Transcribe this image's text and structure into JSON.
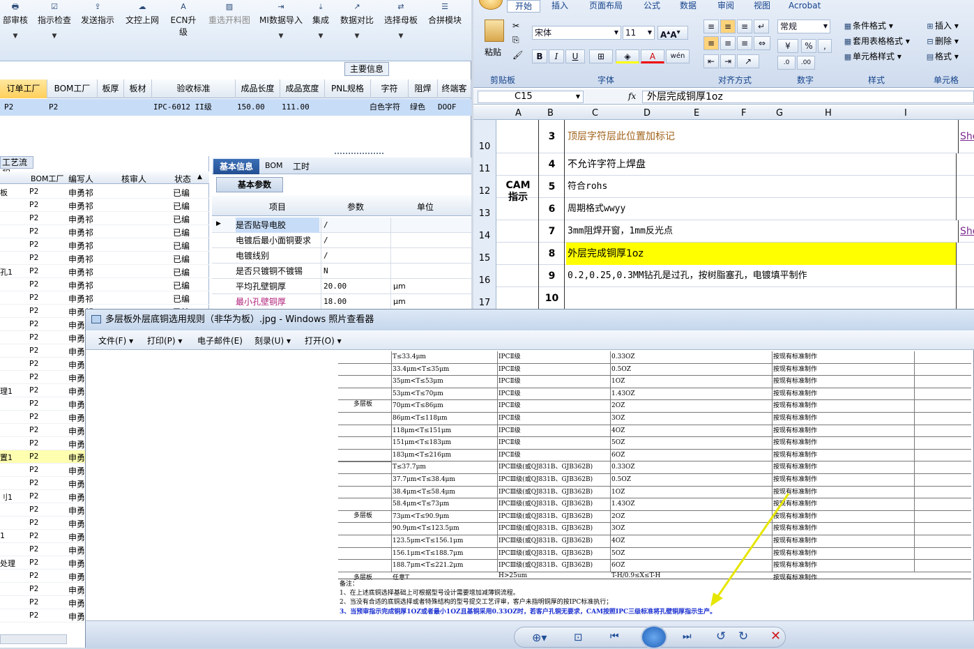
{
  "left_toolbar": [
    "部审核",
    "指示检查",
    "发送指示",
    "文控上网",
    "ECN升级",
    "重选开料图",
    "MI数据导入",
    "集成",
    "数据对比",
    "选择母板",
    "合拼模块"
  ],
  "main_info_label": "主要信息",
  "grid_headers": [
    "订单工厂",
    "BOM工厂",
    "板厚",
    "板材",
    "验收标准",
    "成品长度",
    "成品宽度",
    "PNL规格",
    "字符",
    "阻焊",
    "终端客"
  ],
  "grid_row": [
    "P2",
    "P2",
    "",
    "",
    "IPC-6012 II级",
    "150.00",
    "111.00",
    "",
    "白色字符",
    "绿色",
    "DOOF"
  ],
  "flow_title": "工艺流程",
  "flow_headers": [
    "BOM工厂",
    "编写人",
    "核审人",
    "状态"
  ],
  "flow_left_labels": [
    "板",
    "",
    "",
    "",
    "",
    "",
    "孔1",
    "",
    "",
    "",
    "",
    "",
    "",
    "",
    "",
    "",
    "理1",
    "",
    "",
    "",
    "",
    "",
    "",
    "",
    "",
    "",
    "",
    "",
    ""
  ],
  "flow_left_labels_b": {
    "6": "孔1",
    "15": "理1",
    "20": "置1",
    "23": "刂1",
    "26": "1",
    "28": "处理"
  },
  "flow_factory": "P2",
  "flow_writer": "申勇祁",
  "flow_writer_short": "申勇",
  "flow_status": "已编",
  "basic_tabs": [
    "基本信息",
    "BOM",
    "工时"
  ],
  "basic_subtab": "基本参数",
  "basic_headers": [
    "项目",
    "参数",
    "单位"
  ],
  "basic_rows": [
    [
      "是否贴导电胶",
      "/",
      ""
    ],
    [
      "电镀后最小面铜要求",
      "/",
      ""
    ],
    [
      "电镀线别",
      "/",
      ""
    ],
    [
      "是否只镀铜不镀锡",
      "N",
      ""
    ],
    [
      "平均孔壁铜厚",
      "20.00",
      "μm"
    ],
    [
      "最小孔壁铜厚",
      "18.00",
      "μm"
    ]
  ],
  "excel_tabs": [
    "开始",
    "插入",
    "页面布局",
    "公式",
    "数据",
    "审阅",
    "视图",
    "Acrobat"
  ],
  "excel_font": "宋体",
  "excel_size": "11",
  "excel_format": "常规",
  "excel_groups": [
    "剪贴板",
    "字体",
    "对齐方式",
    "数字",
    "样式",
    "单元格"
  ],
  "excel_styles": [
    "条件格式",
    "套用表格格式",
    "单元格样式"
  ],
  "excel_cells": [
    "插入",
    "删除",
    "格式"
  ],
  "paste_label": "粘贴",
  "name_box": "C15",
  "formula": "外层完成铜厚1oz",
  "col_headers": [
    "A",
    "B",
    "C",
    "D",
    "E",
    "F",
    "G",
    "H",
    "I"
  ],
  "cam_label": "CAM\n指示",
  "sheet_rows": [
    {
      "rn": "10",
      "num": "3",
      "text": "顶层字符层此位置加标记",
      "link": "She"
    },
    {
      "rn": "11",
      "num": "4",
      "text": "不允许字符上焊盘",
      "link": ""
    },
    {
      "rn": "12",
      "num": "5",
      "text": "符合rohs",
      "link": ""
    },
    {
      "rn": "13",
      "num": "6",
      "text": "周期格式wwyy",
      "link": ""
    },
    {
      "rn": "14",
      "num": "7",
      "text": "3mm阻焊开窗，1mm反光点",
      "link": "She"
    },
    {
      "rn": "15",
      "num": "8",
      "text": "外层完成铜厚1oz",
      "link": ""
    },
    {
      "rn": "16",
      "num": "9",
      "text": "0.2,0.25,0.3MM钻孔是过孔，按树脂塞孔，电镀填平制作",
      "link": ""
    },
    {
      "rn": "17",
      "num": "10",
      "text": "",
      "link": ""
    }
  ],
  "viewer_title": "多层板外层底铜选用规则（非华为板）.jpg - Windows 照片查看器",
  "viewer_menu": [
    "文件(F)",
    "打印(P)",
    "电子邮件(E)",
    "刻录(U)",
    "打开(O)"
  ],
  "doc_group1": "多层板",
  "doc_rows1": [
    [
      "T≤33.4μm",
      "IPCⅡ级",
      "0.33OZ",
      "按现有标准制作"
    ],
    [
      "33.4μm<T≤35μm",
      "IPCⅡ级",
      "0.5OZ",
      "按现有标准制作"
    ],
    [
      "35μm<T≤53μm",
      "IPCⅡ级",
      "1OZ",
      "按现有标准制作"
    ],
    [
      "53μm<T≤70μm",
      "IPCⅡ级",
      "1.43OZ",
      "按现有标准制作"
    ],
    [
      "70μm<T≤86μm",
      "IPCⅡ级",
      "2OZ",
      "按现有标准制作"
    ],
    [
      "86μm<T≤118μm",
      "IPCⅡ级",
      "3OZ",
      "按现有标准制作"
    ],
    [
      "118μm<T≤151μm",
      "IPCⅡ级",
      "4OZ",
      "按现有标准制作"
    ],
    [
      "151μm<T≤183μm",
      "IPCⅡ级",
      "5OZ",
      "按现有标准制作"
    ],
    [
      "183μm<T≤216μm",
      "IPCⅡ级",
      "6OZ",
      "按现有标准制作"
    ]
  ],
  "doc_group2": "多层板",
  "doc_rows2": [
    [
      "T≤37.7μm",
      "IPCⅢ级(或QJ831B、GJB362B)",
      "0.33OZ",
      "按现有标准制作"
    ],
    [
      "37.7μm<T≤38.4μm",
      "IPCⅢ级(或QJ831B、GJB362B)",
      "0.5OZ",
      "按现有标准制作"
    ],
    [
      "38.4μm<T≤58.4μm",
      "IPCⅢ级(或QJ831B、GJB362B)",
      "1OZ",
      "按现有标准制作"
    ],
    [
      "58.4μm<T≤73μm",
      "IPCⅢ级(或QJ831B、GJB362B)",
      "1.43OZ",
      "按现有标准制作"
    ],
    [
      "73μm<T≤90.9μm",
      "IPCⅢ级(或QJ831B、GJB362B)",
      "2OZ",
      "按现有标准制作"
    ],
    [
      "90.9μm<T≤123.5μm",
      "IPCⅢ级(或QJ831B、GJB362B)",
      "3OZ",
      "按现有标准制作"
    ],
    [
      "123.5μm<T≤156.1μm",
      "IPCⅢ级(或QJ831B、GJB362B)",
      "4OZ",
      "按现有标准制作"
    ],
    [
      "156.1μm<T≤188.7μm",
      "IPCⅢ级(或QJ831B、GJB362B)",
      "5OZ",
      "按现有标准制作"
    ],
    [
      "188.7μm<T≤221.2μm",
      "IPCⅢ级(或QJ831B、GJB362B)",
      "6OZ",
      "按现有标准制作"
    ]
  ],
  "doc_row3": [
    "多层板",
    "任意T",
    "H>25um",
    "T-H/0.9≤X≤T-H",
    "按现有标准制作"
  ],
  "notes": [
    "备注：",
    "1、在上述底铜选择基础上可根据型号设计需要增加减薄铜流程。",
    "2、当没有合适的底铜选择或者特殊结构的型号提交工艺评审，客户未指明铜厚的按IPC标准执行；",
    "3、当预审指示完成铜厚1OZ或者最小1OZ且基铜采用0.33OZ时，若客户孔铜无要求，CAM按照IPC三级标准将孔壁铜厚指示生产。"
  ],
  "colors": {
    "highlight": "#ffff00",
    "grid_sel": "#c7dcf7",
    "note_blue": "#1a2fd0",
    "arrow": "#e6e600"
  }
}
